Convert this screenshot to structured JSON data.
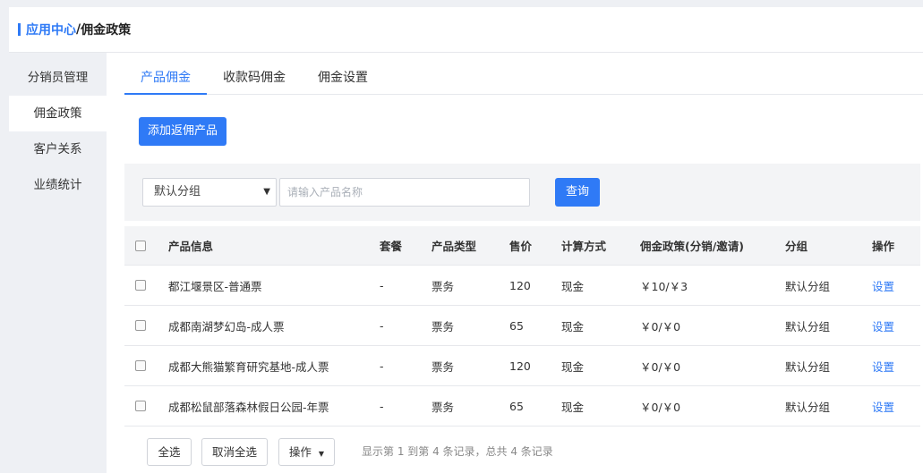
{
  "breadcrumb": {
    "parent": "应用中心",
    "separator": "/",
    "current": "佣金政策"
  },
  "sidebar": {
    "items": [
      {
        "label": "分销员管理",
        "active": false
      },
      {
        "label": "佣金政策",
        "active": true
      },
      {
        "label": "客户关系",
        "active": false
      },
      {
        "label": "业绩统计",
        "active": false
      }
    ]
  },
  "tabs": [
    {
      "label": "产品佣金",
      "active": true
    },
    {
      "label": "收款码佣金",
      "active": false
    },
    {
      "label": "佣金设置",
      "active": false
    }
  ],
  "toolbar": {
    "add_label": "添加返佣产品"
  },
  "filter": {
    "group_selected": "默认分组",
    "search_placeholder": "请输入产品名称",
    "query_label": "查询"
  },
  "table": {
    "headers": [
      "产品信息",
      "套餐",
      "产品类型",
      "售价",
      "计算方式",
      "佣金政策(分销/邀请)",
      "分组",
      "操作"
    ],
    "rows": [
      {
        "name": "都江堰景区-普通票",
        "package": "-",
        "type": "票务",
        "price": "120",
        "method": "现金",
        "commission": "￥10/￥3",
        "group": "默认分组",
        "action": "设置"
      },
      {
        "name": "成都南湖梦幻岛-成人票",
        "package": "-",
        "type": "票务",
        "price": "65",
        "method": "现金",
        "commission": "￥0/￥0",
        "group": "默认分组",
        "action": "设置"
      },
      {
        "name": "成都大熊猫繁育研究基地-成人票",
        "package": "-",
        "type": "票务",
        "price": "120",
        "method": "现金",
        "commission": "￥0/￥0",
        "group": "默认分组",
        "action": "设置"
      },
      {
        "name": "成都松鼠部落森林假日公园-年票",
        "package": "-",
        "type": "票务",
        "price": "65",
        "method": "现金",
        "commission": "￥0/￥0",
        "group": "默认分组",
        "action": "设置"
      }
    ]
  },
  "footer": {
    "select_all": "全选",
    "deselect_all": "取消全选",
    "ops": "操作",
    "summary": "显示第 1 到第 4 条记录，总共 4 条记录"
  },
  "colors": {
    "accent": "#2f7af6",
    "sidebar_bg": "#eef0f4",
    "filter_bg": "#f3f4f6"
  },
  "icons": {
    "select_caret": "caret-down-icon",
    "ops_caret": "caret-down-icon"
  }
}
